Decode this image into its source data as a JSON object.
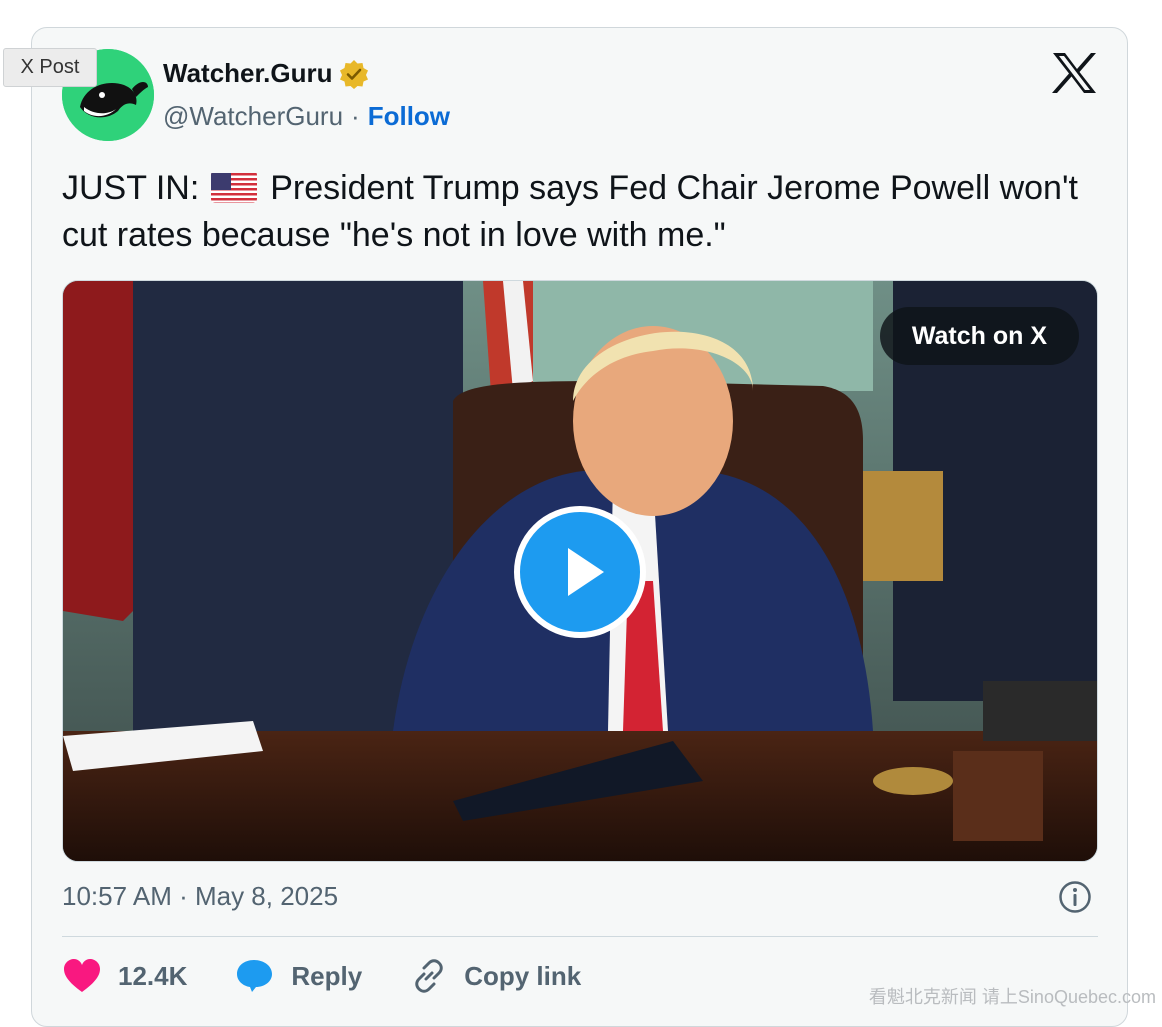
{
  "label": "X Post",
  "author": {
    "name": "Watcher.Guru",
    "handle": "@WatcherGuru",
    "separator": "·",
    "follow_label": "Follow"
  },
  "tweet": {
    "text_before_flag": "JUST IN:",
    "flag_icon": "us-flag-emoji",
    "text_after_flag": "President Trump says Fed Chair Jerome Powell won't cut rates because \"he's not in love with me.\""
  },
  "media": {
    "watch_label": "Watch on X",
    "play_icon": "play-icon"
  },
  "meta": {
    "timestamp": "10:57 AM · May 8, 2025"
  },
  "actions": {
    "likes": "12.4K",
    "reply_label": "Reply",
    "copy_link_label": "Copy link"
  },
  "watermark": "看魁北克新闻 请上SinoQuebec.com",
  "colors": {
    "accent": "#1d9bf0",
    "follow": "#0b6bd5",
    "like": "#f91880",
    "avatar_bg": "#2fd27a",
    "verified": "#e8b829"
  }
}
